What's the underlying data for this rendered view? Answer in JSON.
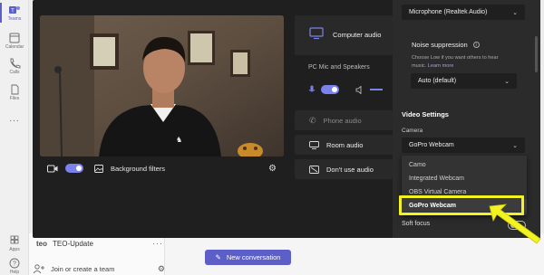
{
  "rail": {
    "items": [
      {
        "label": "Teams"
      },
      {
        "label": "Calendar"
      },
      {
        "label": "Calls"
      },
      {
        "label": "Files"
      }
    ],
    "more": "...",
    "apps_label": "Apps",
    "help_label": "Help"
  },
  "background": {
    "team_logo": "teo",
    "team_name": "TEO-Update",
    "join_label": "Join or create a team",
    "new_conversation": "New conversation"
  },
  "video": {
    "background_filters": "Background filters"
  },
  "audio": {
    "computer_audio": "Computer audio",
    "pc_mic_speakers": "PC Mic and Speakers",
    "phone_audio": "Phone audio",
    "room_audio": "Room audio",
    "dont_use_audio": "Don't use audio"
  },
  "settings": {
    "microphone_value": "Microphone (Realtek Audio)",
    "noise_suppression_label": "Noise suppression",
    "noise_hint_1": "Choose Low if you want others to hear",
    "noise_hint_2": "music.",
    "learn_more": "Learn more",
    "noise_value": "Auto (default)",
    "video_settings_heading": "Video Settings",
    "camera_label": "Camera",
    "camera_value": "GoPro Webcam",
    "camera_options": [
      "Camo",
      "Integrated Webcam",
      "OBS Virtual Camera",
      "GoPro Webcam"
    ],
    "soft_focus_label": "Soft focus"
  },
  "colors": {
    "accent": "#5b5fc7",
    "highlight": "#f3f321",
    "dialog_bg": "#1f1f1f"
  }
}
